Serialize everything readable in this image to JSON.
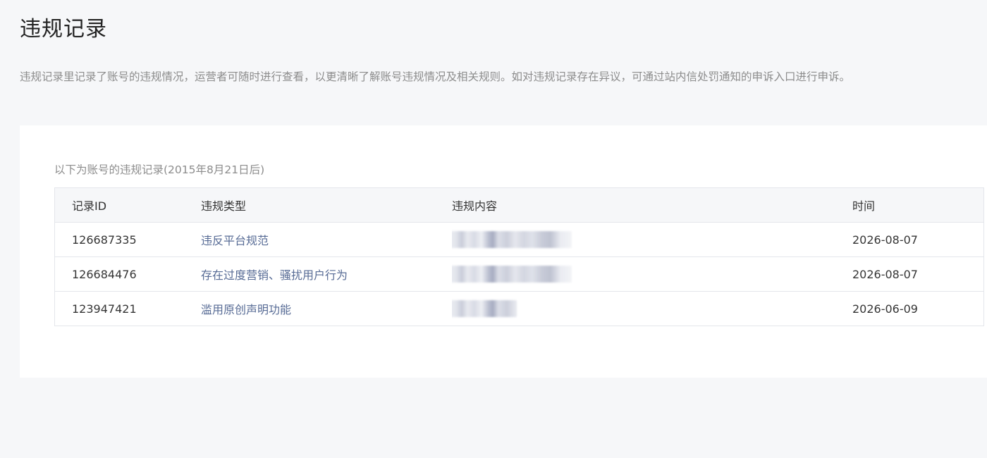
{
  "page": {
    "title": "违规记录",
    "description": "违规记录里记录了账号的违规情况，运营者可随时进行查看，以更清晰了解账号违规情况及相关规则。如对违规记录存在异议，可通过站内信处罚通知的申诉入口进行申诉。"
  },
  "records": {
    "caption": "以下为账号的违规记录(2015年8月21日后)",
    "headers": {
      "id": "记录ID",
      "type": "违规类型",
      "content": "违规内容",
      "time": "时间"
    },
    "rows": [
      {
        "id": "126687335",
        "type": "违反平台规范",
        "content_redacted": true,
        "time": "2026-08-07"
      },
      {
        "id": "126684476",
        "type": "存在过度营销、骚扰用户行为",
        "content_redacted": true,
        "time": "2026-08-07"
      },
      {
        "id": "123947421",
        "type": "滥用原创声明功能",
        "content_redacted": true,
        "time": "2026-06-09"
      }
    ]
  },
  "colors": {
    "link": "#576b95",
    "background": "#f6f7f9",
    "card": "#ffffff",
    "muted_text": "#8c8c8c"
  }
}
